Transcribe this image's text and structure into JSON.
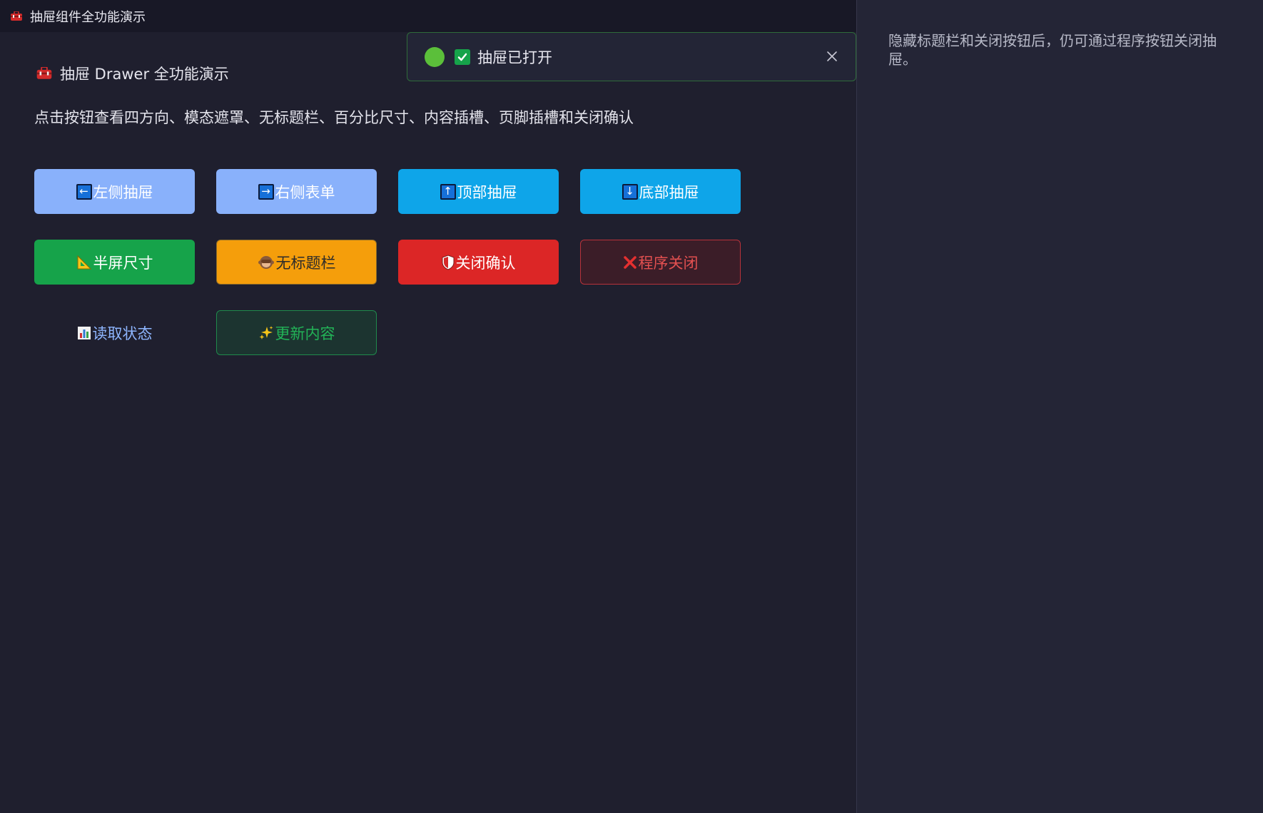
{
  "window": {
    "title": "抽屉组件全功能演示"
  },
  "main": {
    "heading": "抽屉 Drawer 全功能演示",
    "description": "点击按钮查看四方向、模态遮罩、无标题栏、百分比尺寸、内容插槽、页脚插槽和关闭确认"
  },
  "buttons": {
    "left_drawer": "左侧抽屉",
    "right_form": "右侧表单",
    "top_drawer": "顶部抽屉",
    "bottom_drawer": "底部抽屉",
    "half_screen": "半屏尺寸",
    "no_titlebar": "无标题栏",
    "close_confirm": "关闭确认",
    "program_close": "程序关闭",
    "read_state": "读取状态",
    "update_content": "更新内容"
  },
  "toast": {
    "message": "抽屉已打开"
  },
  "drawer": {
    "text": "隐藏标题栏和关闭按钮后，仍可通过程序按钮关闭抽屉。"
  },
  "colors": {
    "bg": "#1f1f2e",
    "titlebar": "#181826",
    "drawer_bg": "#242536",
    "blue_light": "#89b1fb",
    "sky": "#0ea5e9",
    "green": "#16a34a",
    "amber": "#f59e0b",
    "red": "#dc2626"
  }
}
